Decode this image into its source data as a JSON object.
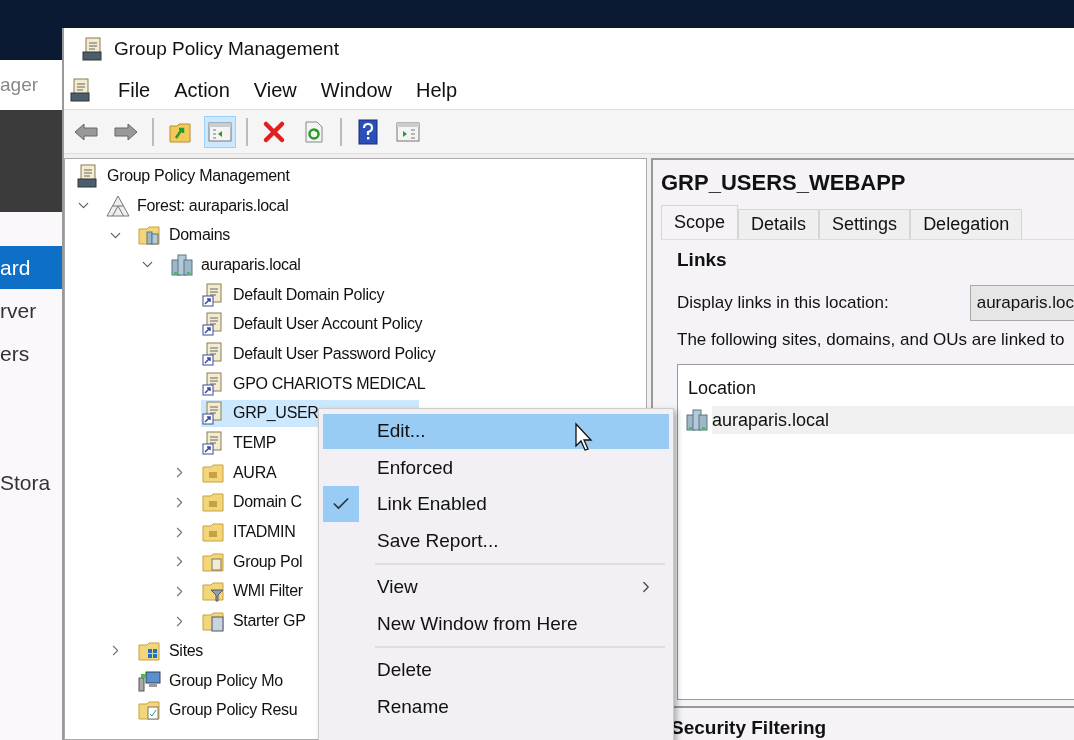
{
  "background_window": {
    "title_fragment": "ager",
    "nav": [
      {
        "label": "ard",
        "selected": true
      },
      {
        "label": "rver",
        "selected": false
      },
      {
        "label": "ers",
        "selected": false
      },
      {
        "label": "Stora",
        "selected": false
      }
    ]
  },
  "window": {
    "title": "Group Policy Management"
  },
  "menu_bar": [
    "File",
    "Action",
    "View",
    "Window",
    "Help"
  ],
  "toolbar": [
    {
      "kind": "back",
      "pressed": false
    },
    {
      "kind": "forward",
      "pressed": false
    },
    {
      "kind": "separator"
    },
    {
      "kind": "up",
      "pressed": false
    },
    {
      "kind": "console-tree",
      "pressed": true
    },
    {
      "kind": "separator"
    },
    {
      "kind": "delete",
      "pressed": false
    },
    {
      "kind": "refresh",
      "pressed": false
    },
    {
      "kind": "separator"
    },
    {
      "kind": "help",
      "pressed": false
    },
    {
      "kind": "action-pane",
      "pressed": false
    }
  ],
  "tree": [
    {
      "label": "Group Policy Management",
      "kind": "gpm",
      "selected": false,
      "children": [
        {
          "label": "Forest: auraparis.local",
          "kind": "forest",
          "selected": false,
          "expanded": true,
          "children": [
            {
              "label": "Domains",
              "kind": "domains",
              "selected": false,
              "expanded": true,
              "children": [
                {
                  "label": "auraparis.local",
                  "kind": "domain",
                  "selected": false,
                  "expanded": true,
                  "children": [
                    {
                      "label": "Default Domain Policy",
                      "kind": "gpo",
                      "selected": false
                    },
                    {
                      "label": "Default User Account Policy",
                      "kind": "gpo",
                      "selected": false
                    },
                    {
                      "label": "Default User Password Policy",
                      "kind": "gpo",
                      "selected": false
                    },
                    {
                      "label": "GPO CHARIOTS MEDICAL",
                      "kind": "gpo",
                      "selected": false
                    },
                    {
                      "label": "GRP_USER",
                      "kind": "gpo",
                      "selected": true
                    },
                    {
                      "label": "TEMP",
                      "kind": "gpo",
                      "selected": false
                    },
                    {
                      "label": "AURA",
                      "kind": "ou",
                      "selected": false,
                      "expanded": false
                    },
                    {
                      "label": "Domain C",
                      "kind": "ou",
                      "selected": false,
                      "expanded": false
                    },
                    {
                      "label": "ITADMIN",
                      "kind": "ou",
                      "selected": false,
                      "expanded": false
                    },
                    {
                      "label": "Group Pol",
                      "kind": "gpo-folder",
                      "selected": false,
                      "expanded": false
                    },
                    {
                      "label": "WMI Filter",
                      "kind": "filter-folder",
                      "selected": false,
                      "expanded": false
                    },
                    {
                      "label": "Starter GP",
                      "kind": "starter-folder",
                      "selected": false,
                      "expanded": false
                    }
                  ]
                }
              ]
            },
            {
              "label": "Sites",
              "kind": "sites",
              "selected": false,
              "expanded": false
            },
            {
              "label": "Group Policy Mo",
              "kind": "modeling",
              "selected": false
            },
            {
              "label": "Group Policy Resu",
              "kind": "results",
              "selected": false
            }
          ]
        }
      ]
    }
  ],
  "details": {
    "title": "GRP_USERS_WEBAPP",
    "tabs": [
      {
        "label": "Scope",
        "selected": true
      },
      {
        "label": "Details",
        "selected": false
      },
      {
        "label": "Settings",
        "selected": false
      },
      {
        "label": "Delegation",
        "selected": false
      }
    ],
    "links_heading": "Links",
    "location_label": "Display links in this location:",
    "location_value": "auraparis.loc",
    "linked_text": "The following sites, domains, and OUs are linked to",
    "table": {
      "columns": [
        "Location"
      ],
      "rows": [
        {
          "kind": "domain",
          "location": "auraparis.local"
        }
      ]
    },
    "security_heading": "Security Filtering"
  },
  "context_menu": {
    "items": [
      {
        "kind": "item",
        "label": "Edit...",
        "highlighted": true,
        "checked": false
      },
      {
        "kind": "item",
        "label": "Enforced",
        "highlighted": false,
        "checked": false
      },
      {
        "kind": "item",
        "label": "Link Enabled",
        "highlighted": false,
        "checked": true
      },
      {
        "kind": "item",
        "label": "Save Report...",
        "highlighted": false,
        "checked": false
      },
      {
        "kind": "separator"
      },
      {
        "kind": "submenu",
        "label": "View",
        "highlighted": false,
        "checked": false
      },
      {
        "kind": "item",
        "label": "New Window from Here",
        "highlighted": false,
        "checked": false
      },
      {
        "kind": "separator"
      },
      {
        "kind": "item",
        "label": "Delete",
        "highlighted": false,
        "checked": false
      },
      {
        "kind": "item",
        "label": "Rename",
        "highlighted": false,
        "checked": false
      }
    ]
  }
}
